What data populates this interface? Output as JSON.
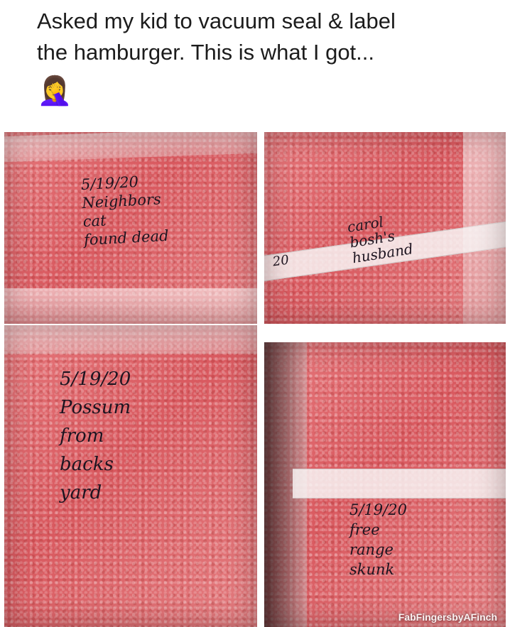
{
  "post": {
    "caption_line1": "Asked my kid to vacuum seal & label",
    "caption_line2": "the hamburger. This is what I got...",
    "emoji": "🤦‍♀️"
  },
  "panels": [
    {
      "name": "panel-top-left",
      "label": "5/19/20\nNeighbors\ncat\nfound dead"
    },
    {
      "name": "panel-top-right",
      "label_prefix": "20",
      "label": "carol\nbosh's\nhusband"
    },
    {
      "name": "panel-bottom-left",
      "label": "5/19/20\nPossum\nfrom\nbacks\nyard"
    },
    {
      "name": "panel-bottom-right",
      "label": "5/19/20\nfree\nrange\nskunk"
    }
  ],
  "watermark": "FabFingersbyAFinch",
  "colors": {
    "meat": "#dc6268",
    "ink": "#1d1420",
    "background": "#ffffff"
  }
}
